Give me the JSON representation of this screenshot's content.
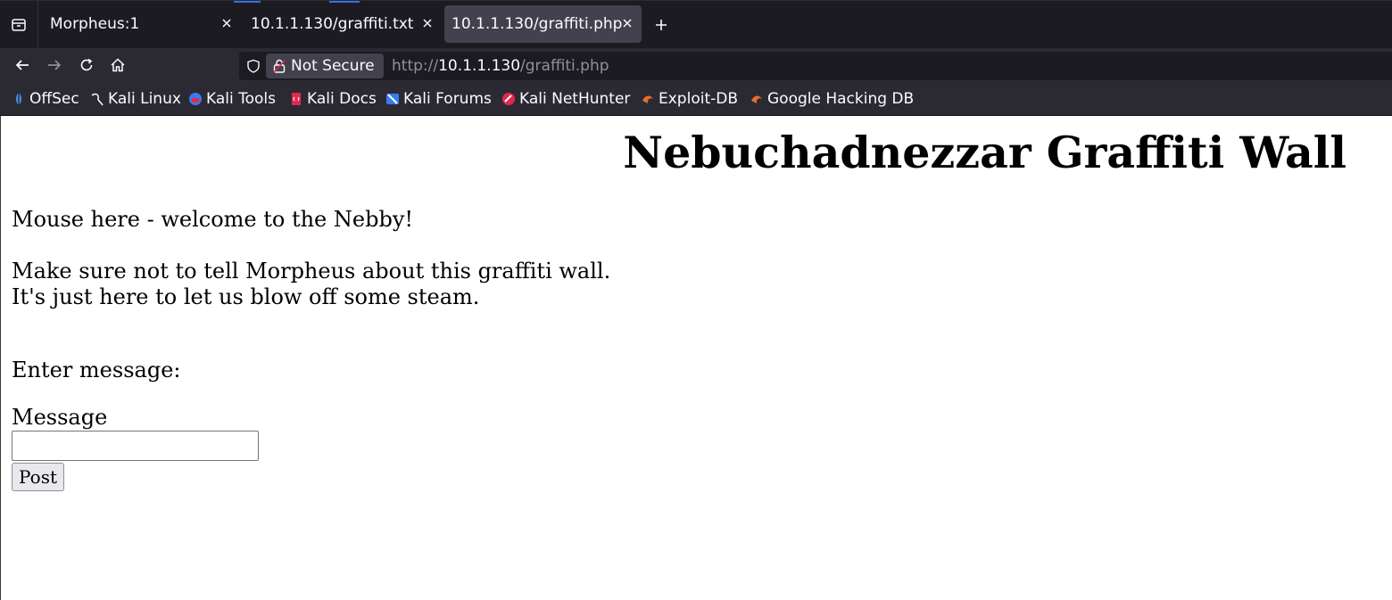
{
  "browser": {
    "tabs": [
      {
        "label": "Morpheus:1",
        "active": false
      },
      {
        "label": "10.1.1.130/graffiti.txt",
        "active": false
      },
      {
        "label": "10.1.1.130/graffiti.php",
        "active": true
      }
    ],
    "new_tab_icon": "plus-icon",
    "nav": {
      "back_icon": "arrow-left-icon",
      "forward_icon": "arrow-right-icon",
      "reload_icon": "reload-icon",
      "home_icon": "home-icon"
    },
    "urlbar": {
      "security_label": "Not Secure",
      "url_scheme": "http://",
      "url_host": "10.1.1.130",
      "url_path": "/graffiti.php"
    },
    "bookmarks": [
      {
        "label": "OffSec",
        "icon": "offsec-icon"
      },
      {
        "label": "Kali Linux",
        "icon": "kali-dragon-icon"
      },
      {
        "label": "Kali Tools",
        "icon": "kali-tools-icon"
      },
      {
        "label": "Kali Docs",
        "icon": "kali-docs-icon"
      },
      {
        "label": "Kali Forums",
        "icon": "kali-forums-icon"
      },
      {
        "label": "Kali NetHunter",
        "icon": "nethunter-icon"
      },
      {
        "label": "Exploit-DB",
        "icon": "exploit-db-icon"
      },
      {
        "label": "Google Hacking DB",
        "icon": "ghdb-icon"
      }
    ]
  },
  "page": {
    "title": "Nebuchadnezzar Graffiti Wall",
    "messages": [
      "Mouse here - welcome to the Nebby!",
      "Make sure not to tell Morpheus about this graffiti wall.",
      "It's just here to let us blow off some steam."
    ],
    "enter_label": "Enter message:",
    "message_label": "Message",
    "message_value": "",
    "post_label": "Post"
  },
  "colors": {
    "tabstrip_bg": "#1c1b22",
    "toolbar_bg": "#2b2a33",
    "active_tab_bg": "#42414d",
    "text_light": "#fbfbfe",
    "url_dim": "#8f8f9d"
  }
}
